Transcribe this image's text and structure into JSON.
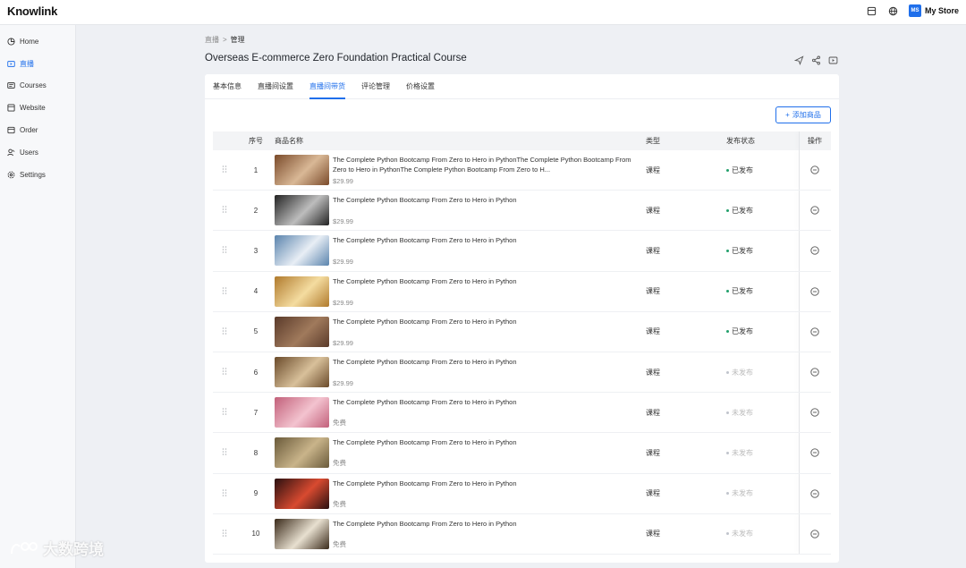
{
  "app": {
    "logo": "Knowlink",
    "store_badge": "MS",
    "store_name": "My Store"
  },
  "sidebar": {
    "items": [
      {
        "label": "Home",
        "icon": "home-icon",
        "active": false
      },
      {
        "label": "直播",
        "icon": "live-icon",
        "active": true
      },
      {
        "label": "Courses",
        "icon": "courses-icon",
        "active": false
      },
      {
        "label": "Website",
        "icon": "website-icon",
        "active": false
      },
      {
        "label": "Order",
        "icon": "order-icon",
        "active": false
      },
      {
        "label": "Users",
        "icon": "users-icon",
        "active": false
      },
      {
        "label": "Settings",
        "icon": "settings-icon",
        "active": false
      }
    ]
  },
  "breadcrumb": {
    "parent": "直播",
    "separator": ">",
    "current": "管理"
  },
  "page": {
    "title": "Overseas E-commerce Zero Foundation Practical Course"
  },
  "tabs": [
    {
      "label": "基本信息",
      "active": false
    },
    {
      "label": "直播间设置",
      "active": false
    },
    {
      "label": "直播间带货",
      "active": true
    },
    {
      "label": "评论管理",
      "active": false
    },
    {
      "label": "价格设置",
      "active": false
    }
  ],
  "add_button": {
    "label": "添加商品",
    "plus": "+"
  },
  "table": {
    "headers": {
      "index": "序号",
      "name": "商品名称",
      "type": "类型",
      "status": "发布状态",
      "op": "操作"
    },
    "rows": [
      {
        "index": "1",
        "name": "The Complete Python Bootcamp From Zero to Hero in PythonThe Complete Python Bootcamp From Zero to Hero in PythonThe Complete Python Bootcamp From Zero to H...",
        "price": "$29.99",
        "type": "课程",
        "status": "已发布",
        "published": true,
        "thumb": [
          "#7a4a2a",
          "#d9b896"
        ]
      },
      {
        "index": "2",
        "name": "The Complete Python Bootcamp From Zero to Hero in Python",
        "price": "$29.99",
        "type": "课程",
        "status": "已发布",
        "published": true,
        "thumb": [
          "#222222",
          "#bdbdbd"
        ]
      },
      {
        "index": "3",
        "name": "The Complete Python Bootcamp From Zero to Hero in Python",
        "price": "$29.99",
        "type": "课程",
        "status": "已发布",
        "published": true,
        "thumb": [
          "#5a84ad",
          "#e8eef5"
        ]
      },
      {
        "index": "4",
        "name": "The Complete Python Bootcamp From Zero to Hero in Python",
        "price": "$29.99",
        "type": "课程",
        "status": "已发布",
        "published": true,
        "thumb": [
          "#b07a2c",
          "#f4dca0"
        ]
      },
      {
        "index": "5",
        "name": "The Complete Python Bootcamp From Zero to Hero in Python",
        "price": "$29.99",
        "type": "课程",
        "status": "已发布",
        "published": true,
        "thumb": [
          "#5a3a2a",
          "#a07a5c"
        ]
      },
      {
        "index": "6",
        "name": "The Complete Python Bootcamp From Zero to Hero in Python",
        "price": "$29.99",
        "type": "课程",
        "status": "未发布",
        "published": false,
        "thumb": [
          "#6a4a2a",
          "#d8c09a"
        ]
      },
      {
        "index": "7",
        "name": "The Complete Python Bootcamp From Zero to Hero in Python",
        "price": "免费",
        "type": "课程",
        "status": "未发布",
        "published": false,
        "thumb": [
          "#c2607a",
          "#f3c3cf"
        ]
      },
      {
        "index": "8",
        "name": "The Complete Python Bootcamp From Zero to Hero in Python",
        "price": "免费",
        "type": "课程",
        "status": "未发布",
        "published": false,
        "thumb": [
          "#6a5a3a",
          "#c9b48a"
        ]
      },
      {
        "index": "9",
        "name": "The Complete Python Bootcamp From Zero to Hero in Python",
        "price": "免费",
        "type": "课程",
        "status": "未发布",
        "published": false,
        "thumb": [
          "#2a1010",
          "#d84a30"
        ]
      },
      {
        "index": "10",
        "name": "The Complete Python Bootcamp From Zero to Hero in Python",
        "price": "免费",
        "type": "课程",
        "status": "未发布",
        "published": false,
        "thumb": [
          "#3a2a1a",
          "#e8e0d0"
        ]
      }
    ]
  },
  "watermark": {
    "text": "大数跨境"
  },
  "colors": {
    "accent": "#1f6feb",
    "published": "#22a06b",
    "unpublished": "#c0c4cc"
  }
}
